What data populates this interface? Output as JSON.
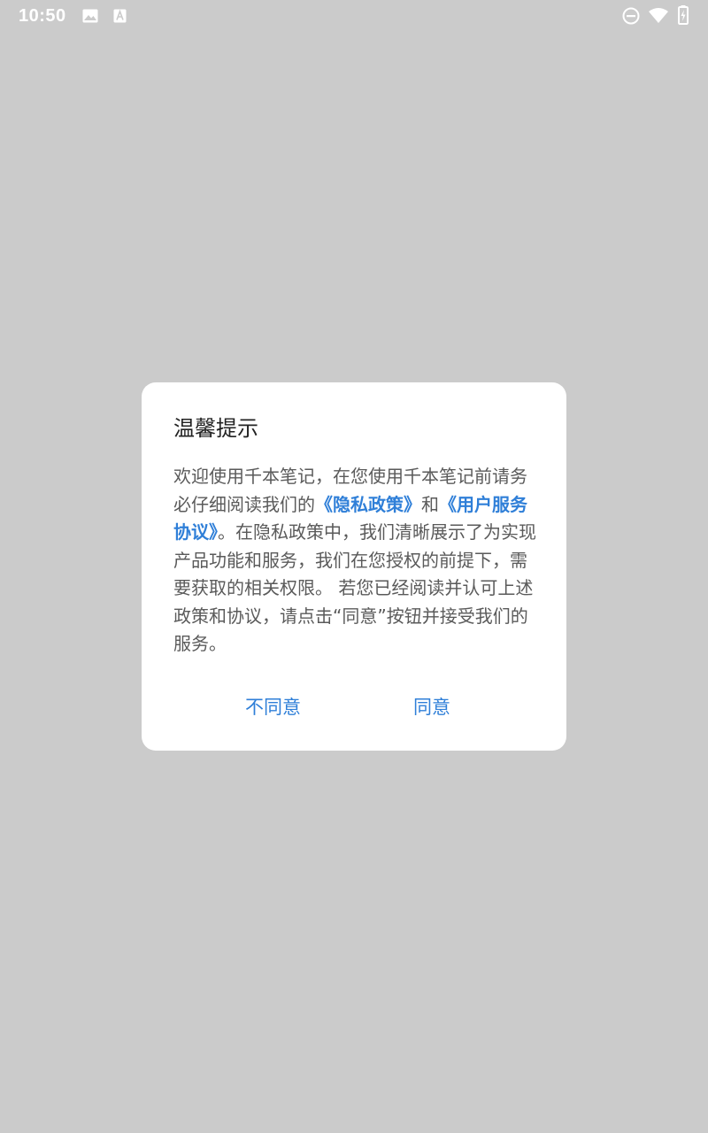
{
  "status_bar": {
    "time": "10:50",
    "icons": [
      "photo-icon",
      "text-a-icon",
      "do-not-disturb-icon",
      "wifi-icon",
      "battery-charging-icon"
    ]
  },
  "dialog": {
    "title": "温馨提示",
    "body": {
      "part1": "欢迎使用千本笔记，在您使用千本笔记前请务必仔细阅读我们的",
      "privacy_link": "《隐私政策》",
      "part2": "和",
      "service_link": "《用户服务协议》",
      "part3": "。在隐私政策中，我们清晰展示了为实现产品功能和服务，我们在您授权的前提下，需要获取的相关权限。 若您已经阅读并认可上述政策和协议，请点击“同意”按钮并接受我们的服务。"
    },
    "buttons": {
      "disagree": "不同意",
      "agree": "同意"
    }
  },
  "colors": {
    "background": "#cbcbcb",
    "dialog": "#ffffff",
    "accent": "#2f7fd8"
  }
}
